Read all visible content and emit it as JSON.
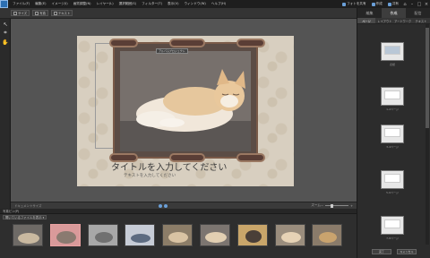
{
  "menubar": {
    "items": [
      "ファイル(F)",
      "編集(E)",
      "イメージ(I)",
      "画質調整(N)",
      "レイヤー(L)",
      "選択範囲(S)",
      "フィルター(T)",
      "表示(V)",
      "ウィンドウ(W)",
      "ヘルプ(H)"
    ],
    "right_items": [
      "フォトを共有",
      "作成",
      "共有"
    ]
  },
  "options": {
    "items": [
      "サイズ",
      "写真",
      "テキスト"
    ]
  },
  "canvas": {
    "chip_label": "アルバムプロジェクト",
    "title_placeholder": "タイトルを入力してください",
    "subtitle_placeholder": "テキストを入力してください"
  },
  "statusbar": {
    "left": "ドキュメントサイズ",
    "zoom_label": "ズーム"
  },
  "bin": {
    "header": "写真ビン(P)",
    "filter": "開いているファイルを表示"
  },
  "right_panel": {
    "tabs": [
      "編集",
      "作成",
      "配信"
    ],
    "active_tab": 1,
    "subtabs": [
      "ページ",
      "レイアウト",
      "アートワーク",
      "テキスト"
    ],
    "active_subtab": 0,
    "page_labels": [
      "表紙",
      "1-2ページ",
      "3-4ページ",
      "5-6ページ",
      "7-8ページ"
    ],
    "buttons": [
      "完了",
      "キャンセル"
    ]
  },
  "colors": {
    "accent": "#2c6fb2",
    "page_background": "#d8cfc0",
    "frame": "#7a5a48"
  }
}
